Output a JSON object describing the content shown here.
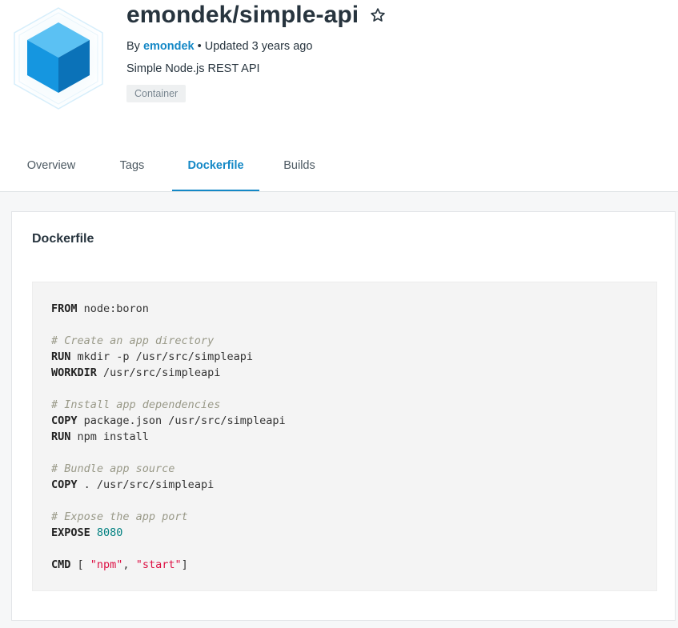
{
  "repo": {
    "name": "emondek/simple-api",
    "by_label": "By",
    "author": "emondek",
    "updated": "• Updated 3 years ago",
    "description": "Simple Node.js REST API",
    "badge": "Container"
  },
  "tabs": [
    {
      "label": "Overview",
      "active": false
    },
    {
      "label": "Tags",
      "active": false
    },
    {
      "label": "Dockerfile",
      "active": true
    },
    {
      "label": "Builds",
      "active": false
    }
  ],
  "card": {
    "title": "Dockerfile"
  },
  "dockerfile": {
    "lines": [
      [
        {
          "t": "FROM",
          "c": "kw"
        },
        {
          "t": " node:boron",
          "c": ""
        }
      ],
      [],
      [
        {
          "t": "# Create an app directory",
          "c": "cm"
        }
      ],
      [
        {
          "t": "RUN",
          "c": "kw"
        },
        {
          "t": " mkdir -p /usr/src/simpleapi",
          "c": ""
        }
      ],
      [
        {
          "t": "WORKDIR",
          "c": "kw"
        },
        {
          "t": " /usr/src/simpleapi",
          "c": ""
        }
      ],
      [],
      [
        {
          "t": "# Install app dependencies",
          "c": "cm"
        }
      ],
      [
        {
          "t": "COPY",
          "c": "kw"
        },
        {
          "t": " package.json /usr/src/simpleapi",
          "c": ""
        }
      ],
      [
        {
          "t": "RUN",
          "c": "kw"
        },
        {
          "t": " npm install",
          "c": ""
        }
      ],
      [],
      [
        {
          "t": "# Bundle app source",
          "c": "cm"
        }
      ],
      [
        {
          "t": "COPY",
          "c": "kw"
        },
        {
          "t": " . /usr/src/simpleapi",
          "c": ""
        }
      ],
      [],
      [
        {
          "t": "# Expose the app port",
          "c": "cm"
        }
      ],
      [
        {
          "t": "EXPOSE",
          "c": "kw"
        },
        {
          "t": " ",
          "c": ""
        },
        {
          "t": "8080",
          "c": "num"
        }
      ],
      [],
      [
        {
          "t": "CMD",
          "c": "kw"
        },
        {
          "t": " [ ",
          "c": ""
        },
        {
          "t": "\"npm\"",
          "c": "str"
        },
        {
          "t": ", ",
          "c": ""
        },
        {
          "t": "\"start\"",
          "c": "str"
        },
        {
          "t": "]",
          "c": ""
        }
      ]
    ]
  },
  "colors": {
    "accent": "#1488c6",
    "text": "#27343e",
    "page_bg": "#f6f7f8"
  },
  "icons": {
    "logo": "cube-logo-icon",
    "star": "star-outline-icon"
  }
}
